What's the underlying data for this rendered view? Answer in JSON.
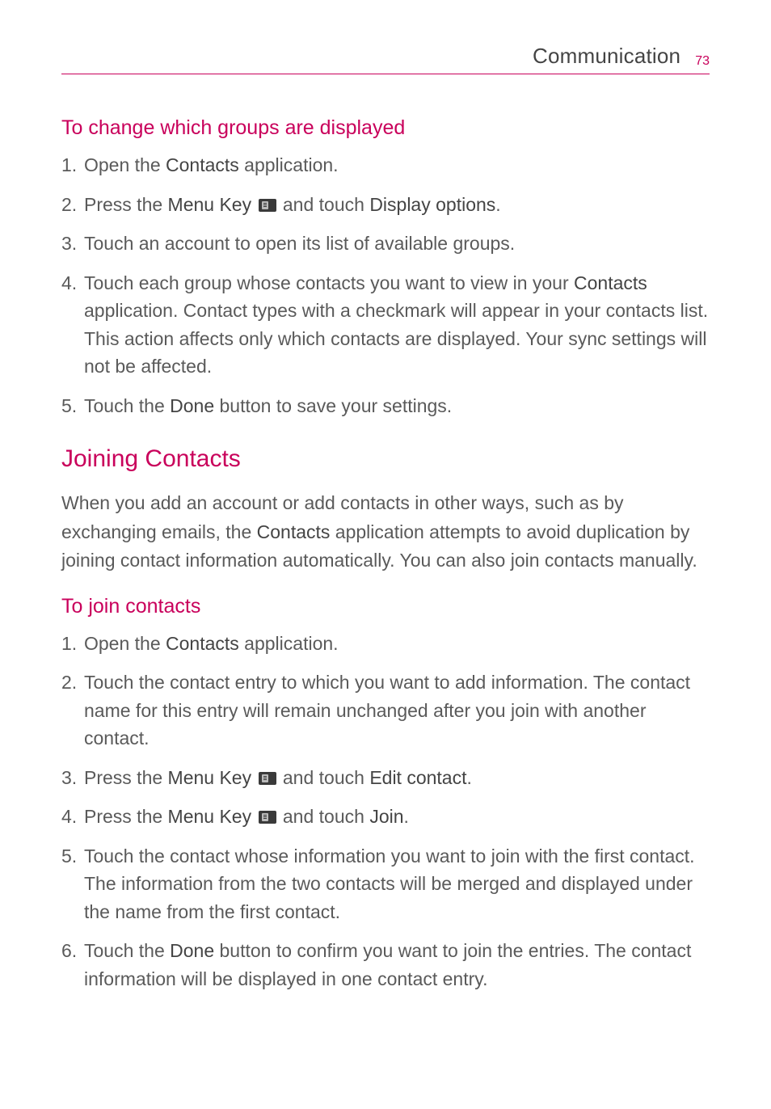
{
  "header": {
    "title": "Communication",
    "page_number": "73"
  },
  "section1": {
    "heading": "To change which groups are displayed",
    "items": [
      {
        "num": "1.",
        "pre": "Open the ",
        "bold1": "Contacts",
        "post1": " application."
      },
      {
        "num": "2.",
        "pre": "Press the ",
        "bold1": "Menu Key",
        "icon": true,
        "mid": " and touch ",
        "bold2": "Display options",
        "post2": "."
      },
      {
        "num": "3.",
        "text": "Touch an account to open its list of available groups."
      },
      {
        "num": "4.",
        "pre": "Touch each group whose contacts you want to view in your ",
        "bold1": "Contacts",
        "post1": " application. Contact types with a checkmark will appear in your contacts list. This action affects only which contacts are displayed. Your sync settings will not be affected."
      },
      {
        "num": "5.",
        "pre": "Touch the ",
        "bold1": "Done",
        "post1": " button to save your settings."
      }
    ]
  },
  "section2": {
    "heading": "Joining Contacts",
    "intro_pre": "When you add an account or add contacts in other ways, such as by exchanging emails, the ",
    "intro_bold": "Contacts",
    "intro_post": " application attempts to avoid duplication by joining contact information automatically. You can also join contacts manually."
  },
  "section3": {
    "heading": "To join contacts",
    "items": [
      {
        "num": "1.",
        "pre": "Open the ",
        "bold1": "Contacts",
        "post1": " application."
      },
      {
        "num": "2.",
        "text": "Touch the contact entry to which you want to add information. The contact name for this entry will remain unchanged after you join with another contact."
      },
      {
        "num": "3.",
        "pre": "Press the ",
        "bold1": "Menu Key",
        "icon": true,
        "mid": " and touch ",
        "bold2": "Edit contact",
        "post2": "."
      },
      {
        "num": "4.",
        "pre": "Press the ",
        "bold1": "Menu Key",
        "icon": true,
        "mid": " and touch ",
        "bold2": "Join",
        "post2": "."
      },
      {
        "num": "5.",
        "text": "Touch the contact whose information you want to join with the first contact. The information from the two contacts will be merged and displayed under the name from the first contact."
      },
      {
        "num": "6.",
        "pre": "Touch the ",
        "bold1": "Done",
        "post1": " button to confirm you want to join the entries. The contact information will be displayed in one contact entry."
      }
    ]
  }
}
